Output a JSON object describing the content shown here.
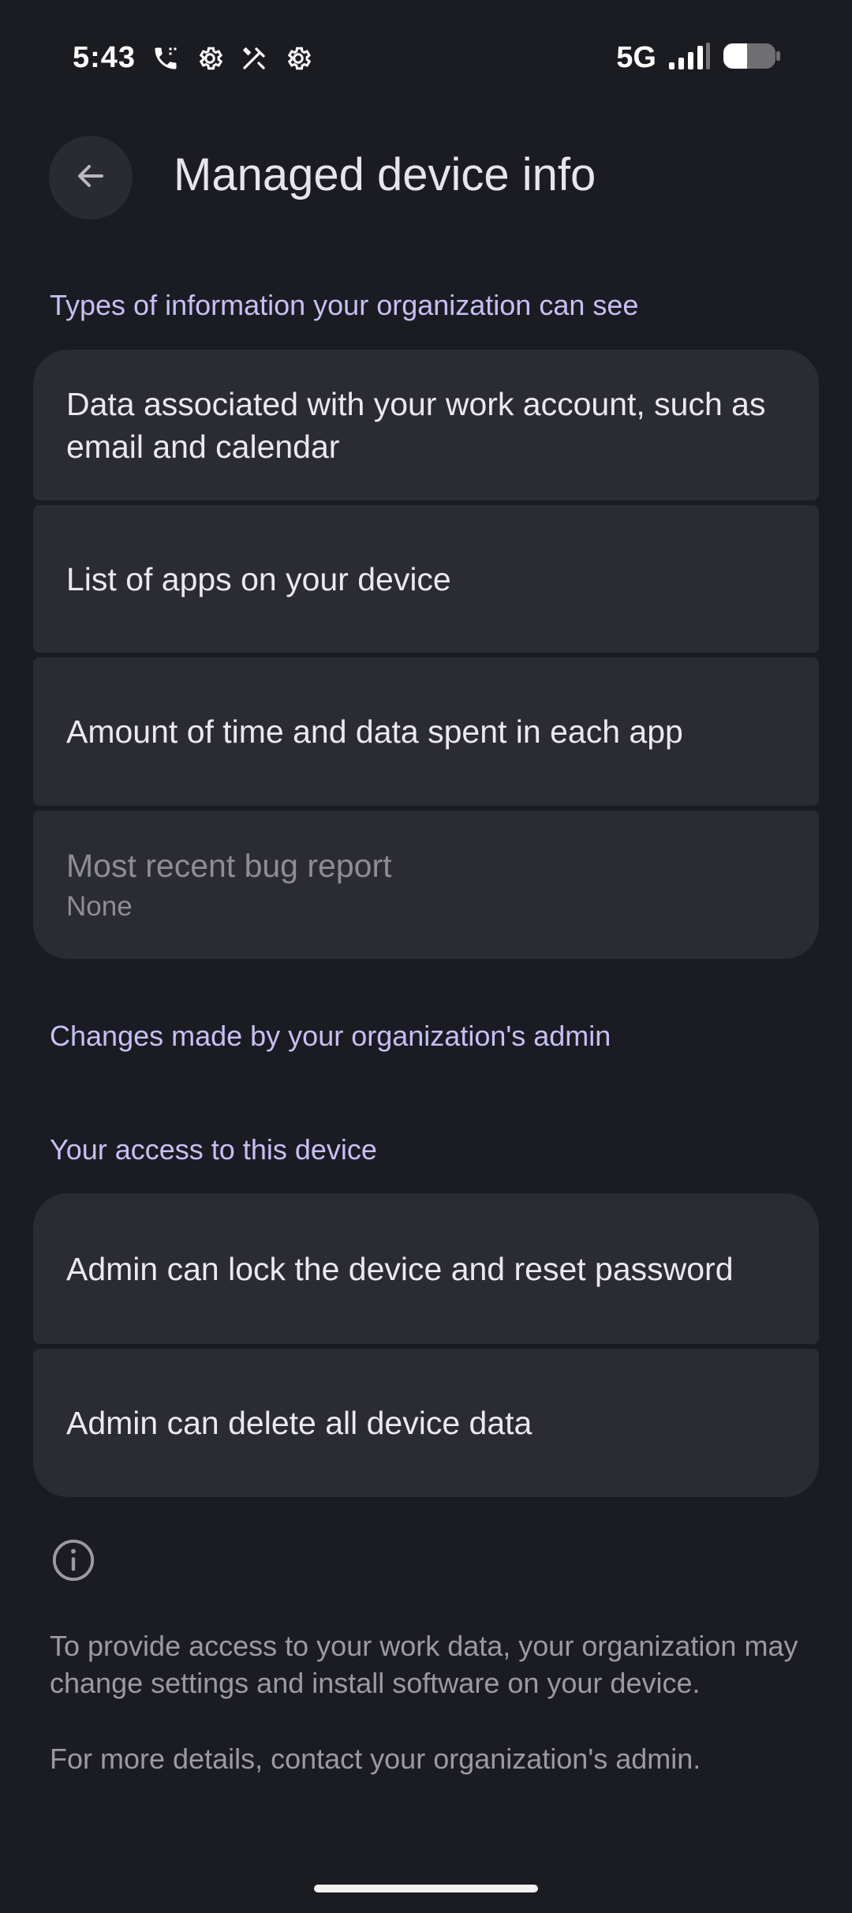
{
  "status_bar": {
    "time": "5:43",
    "network": "5G",
    "icons": [
      "phone-call-icon",
      "settings-icon",
      "tools-icon",
      "settings-icon",
      "signal-icon",
      "battery-icon"
    ]
  },
  "app_bar": {
    "title": "Managed device info",
    "back_icon": "arrow-back-icon"
  },
  "sections": {
    "info_types": {
      "header": "Types of information your organization can see",
      "items": [
        {
          "title": "Data associated with your work account, such as email and calendar"
        },
        {
          "title": "List of apps on your device"
        },
        {
          "title": "Amount of time and data spent in each app"
        },
        {
          "title": "Most recent bug report",
          "subtitle": "None"
        }
      ]
    },
    "admin_changes": {
      "header": "Changes made by your organization's admin"
    },
    "access": {
      "header": "Your access to this device",
      "items": [
        {
          "title": "Admin can lock the device and reset password"
        },
        {
          "title": "Admin can delete all device data"
        }
      ]
    }
  },
  "footer": {
    "icon": "info-icon",
    "paragraph1": "To provide access to your work data, your organization may change settings and install software on your device.",
    "paragraph2": "For more details, contact your organization's admin."
  },
  "colors": {
    "background": "#1b1c21",
    "card": "#2a2b33",
    "accent": "#c7bff7"
  }
}
